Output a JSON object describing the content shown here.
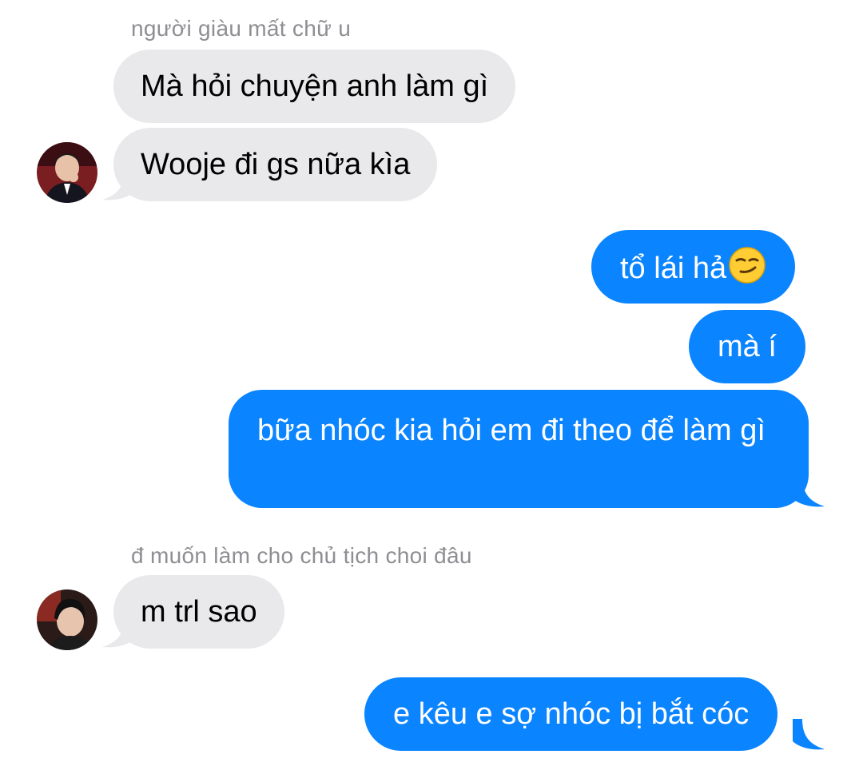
{
  "thread": {
    "group1": {
      "sender_name": "người giàu mất chữ u",
      "messages": [
        "Mà hỏi chuyện anh làm gì",
        "Wooje đi gs nữa kìa"
      ],
      "avatar": "sender-avatar-icon"
    },
    "outgoing1": {
      "messages": [
        "tổ lái hả",
        "mà í",
        "bữa nhóc kia hỏi em đi theo để làm gì"
      ],
      "emoji": "smirking-face-icon"
    },
    "group2": {
      "sender_name": "đ muốn làm cho chủ tịch choi đâu",
      "messages": [
        "m trl sao"
      ],
      "avatar": "sender-avatar-icon"
    },
    "outgoing2": {
      "messages": [
        "e kêu e sợ nhóc bị bắt cóc"
      ]
    }
  },
  "colors": {
    "incoming_bubble": "#e9e9eb",
    "outgoing_bubble": "#0a84ff",
    "sender_name": "#8e8e93"
  }
}
